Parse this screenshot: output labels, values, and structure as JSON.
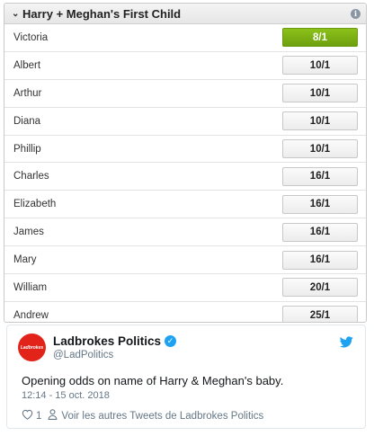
{
  "market": {
    "title": "Harry + Meghan's First Child",
    "collapse_icon": "chevron-down-icon",
    "info_icon": "info-icon",
    "runners": [
      {
        "name": "Victoria",
        "odds": "8/1",
        "favourite": true
      },
      {
        "name": "Albert",
        "odds": "10/1"
      },
      {
        "name": "Arthur",
        "odds": "10/1"
      },
      {
        "name": "Diana",
        "odds": "10/1"
      },
      {
        "name": "Phillip",
        "odds": "10/1"
      },
      {
        "name": "Charles",
        "odds": "16/1"
      },
      {
        "name": "Elizabeth",
        "odds": "16/1"
      },
      {
        "name": "James",
        "odds": "16/1"
      },
      {
        "name": "Mary",
        "odds": "16/1"
      },
      {
        "name": "William",
        "odds": "20/1"
      },
      {
        "name": "Andrew",
        "odds": "25/1"
      }
    ],
    "colors": {
      "favourite": "#7ab015",
      "brand": "#e2231a"
    }
  },
  "tweet": {
    "avatar_text": "Ladbrokes",
    "display_name": "Ladbrokes Politics",
    "handle": "@LadPolitics",
    "verified_icon": "verified-badge-icon",
    "brand_icon": "twitter-bird-icon",
    "text": "Opening odds on name of Harry & Meghan's baby.",
    "timestamp": "12:14 - 15 oct. 2018",
    "like_count": "1",
    "more_tweets_link": "Voir les autres Tweets de Ladbrokes Politics",
    "colors": {
      "twitter_blue": "#1da1f2"
    }
  }
}
